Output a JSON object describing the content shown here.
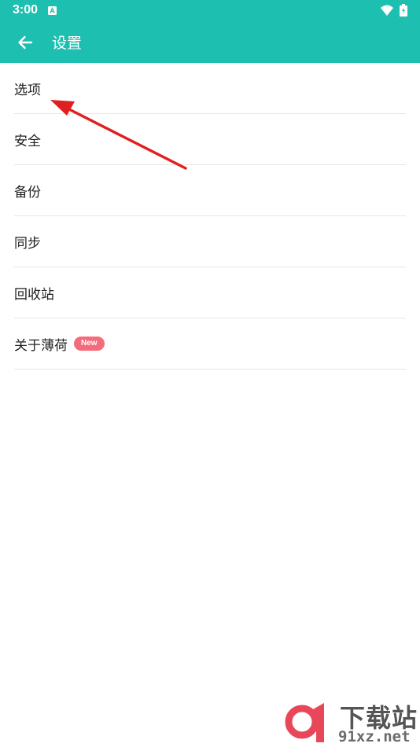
{
  "status_bar": {
    "time": "3:00",
    "icons": [
      "notification-a-icon",
      "wifi-icon",
      "battery-charging-icon"
    ]
  },
  "toolbar": {
    "back_icon": "arrow-left-icon",
    "title": "设置"
  },
  "settings": {
    "items": [
      {
        "label": "选项"
      },
      {
        "label": "安全"
      },
      {
        "label": "备份"
      },
      {
        "label": "同步"
      },
      {
        "label": "回收站"
      },
      {
        "label": "关于薄荷",
        "badge": "New"
      }
    ]
  },
  "annotation": {
    "type": "red-arrow",
    "color": "#e02020",
    "points_to": "选项"
  },
  "watermark": {
    "title": "下载站",
    "site": "91xz.net"
  },
  "colors": {
    "accent": "#1dbfb0",
    "badge": "#f46b7c",
    "divider": "#e6e6e6",
    "text": "#222222"
  }
}
